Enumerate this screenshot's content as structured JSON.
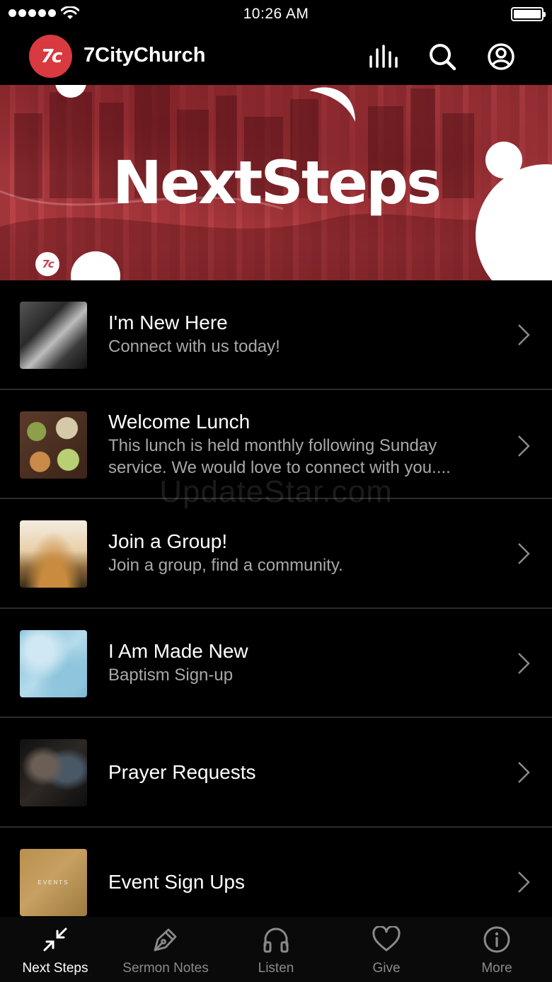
{
  "status_bar": {
    "time": "10:26 AM"
  },
  "header": {
    "logo_text": "7c",
    "title": "7CityChurch"
  },
  "header_icons": [
    "equalizer-icon",
    "search-icon",
    "profile-icon"
  ],
  "banner": {
    "title": "NextSteps",
    "logo_text": "7c"
  },
  "items": [
    {
      "title": "I'm New Here",
      "subtitle": "Connect with us today!"
    },
    {
      "title": "Welcome Lunch",
      "subtitle": "This lunch is held monthly following Sunday service. We would love to connect with you...."
    },
    {
      "title": "Join a Group!",
      "subtitle": "Join a group, find a community."
    },
    {
      "title": "I Am Made New",
      "subtitle": "Baptism Sign-up"
    },
    {
      "title": "Prayer Requests",
      "subtitle": ""
    },
    {
      "title": "Event Sign Ups",
      "subtitle": "",
      "thumb_text": "EVENTS"
    }
  ],
  "watermark": "UpdateStar.com",
  "tabs": [
    {
      "label": "Next Steps",
      "icon": "arrows-collapse-icon",
      "active": true
    },
    {
      "label": "Sermon Notes",
      "icon": "pen-icon",
      "active": false
    },
    {
      "label": "Listen",
      "icon": "headphones-icon",
      "active": false
    },
    {
      "label": "Give",
      "icon": "heart-icon",
      "active": false
    },
    {
      "label": "More",
      "icon": "info-icon",
      "active": false
    }
  ],
  "colors": {
    "brand_red": "#d83a3f",
    "background": "#000000",
    "subtitle_gray": "#a8a8a8",
    "tab_inactive": "#8a8a8a"
  }
}
